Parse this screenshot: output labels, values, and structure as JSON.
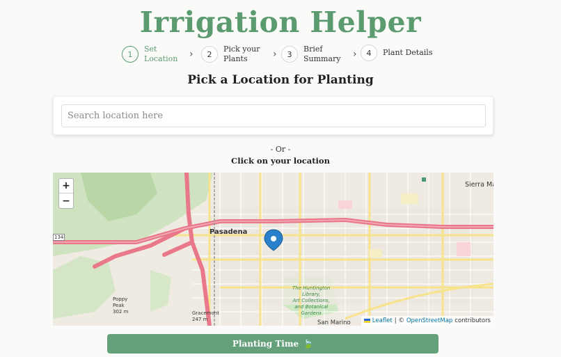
{
  "app": {
    "title": "Irrigation Helper"
  },
  "stepper": {
    "steps": [
      {
        "number": "1",
        "label": "Set Location",
        "active": true
      },
      {
        "number": "2",
        "label": "Pick your Plants",
        "active": false
      },
      {
        "number": "3",
        "label": "Brief Summary",
        "active": false
      },
      {
        "number": "4",
        "label": "Plant Details",
        "active": false
      }
    ],
    "separator_icon": "chevron-right-icon"
  },
  "page": {
    "subtitle": "Pick a Location for Planting",
    "or_text": "- Or -",
    "click_text": "Click on your location"
  },
  "search": {
    "placeholder": "Search location here",
    "value": ""
  },
  "map": {
    "zoom_in_label": "+",
    "zoom_out_label": "−",
    "labels": {
      "pasadena": "Pasadena",
      "sierra": "Sierra Ma",
      "huntington_1": "The Huntington",
      "huntington_2": "Library,",
      "huntington_3": "Art Collections,",
      "huntington_4": "and Botanical",
      "huntington_5": "Gardens",
      "san_marino": "San Marino",
      "poppy_1": "Poppy",
      "poppy_2": "Peak",
      "poppy_3": "302 m",
      "gracemont_1": "Gracemont",
      "gracemont_2": "247 m",
      "route": "134"
    },
    "attribution": {
      "leaflet": "Leaflet",
      "separator": "| ©",
      "osm": "OpenStreetMap",
      "suffix": "contributors"
    },
    "marker_color": "#2a81cb",
    "freeway_color": "#e8788a"
  },
  "cta": {
    "label": "Planting Time",
    "icon": "🍃",
    "color": "#64a07a"
  },
  "colors": {
    "accent": "#5c9a70"
  }
}
